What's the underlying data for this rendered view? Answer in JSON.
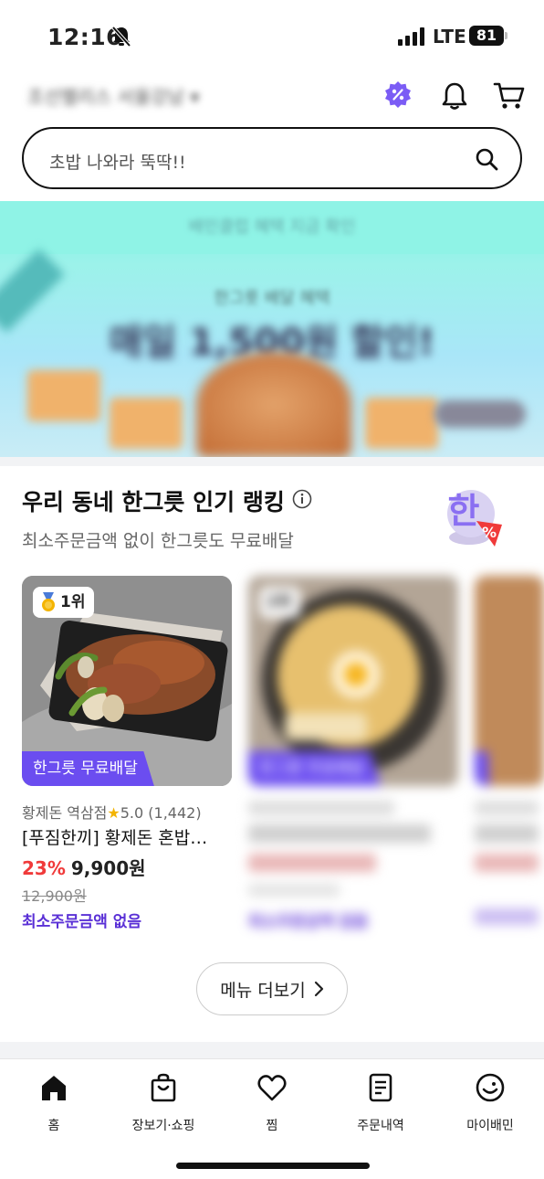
{
  "status_bar": {
    "time": "12:16",
    "network": "LTE",
    "battery": "81"
  },
  "header": {
    "address": "조선팰리스 서울강남 ▾"
  },
  "search": {
    "placeholder": "초밥 나와라 뚝딱!!"
  },
  "banner": {
    "top_text": "배민클럽 혜택 지금 확인",
    "subtitle": "한그릇 배달 혜택",
    "headline": "매일 1,500원 할인!"
  },
  "ranking": {
    "title": "우리 동네 한그릇 인기 랭킹",
    "subtitle": "최소주문금액 없이 한그릇도 무료배달",
    "emblem_text": "한"
  },
  "cards": [
    {
      "rank": "1위",
      "tag": "한그릇 무료배달",
      "store": "황제돈 역삼점",
      "rating": "5.0",
      "reviews": "(1,442)",
      "name": "[푸짐한끼] 황제돈 혼밥…",
      "discount": "23%",
      "price": "9,900원",
      "original_price": "12,900원",
      "min_order": "최소주문금액 없음"
    },
    {
      "rank": "2위",
      "tag": "한그릇 무료배달",
      "store": "",
      "rating": "",
      "reviews": "",
      "name": "",
      "discount": "",
      "price": "",
      "original_price": "",
      "min_order": "최소주문금액 없음"
    }
  ],
  "more_button": {
    "label": "메뉴 더보기"
  },
  "bottom_nav": [
    {
      "label": "홈",
      "icon": "home-icon"
    },
    {
      "label": "장보기·쇼핑",
      "icon": "shopping-bag-icon"
    },
    {
      "label": "찜",
      "icon": "heart-icon"
    },
    {
      "label": "주문내역",
      "icon": "receipt-icon"
    },
    {
      "label": "마이배민",
      "icon": "profile-icon"
    }
  ],
  "colors": {
    "accent": "#6b4df0",
    "discount": "#f03a3a",
    "min_order": "#5a30d6",
    "banner": "#8ff3e6"
  }
}
